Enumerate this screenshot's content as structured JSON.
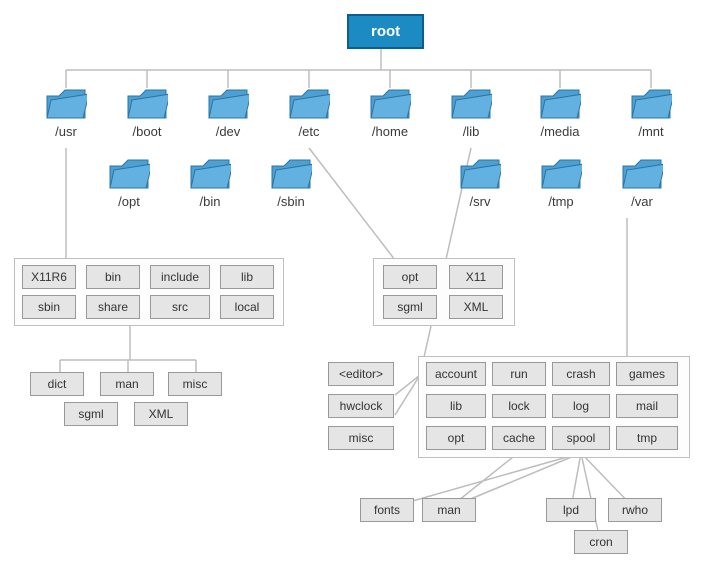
{
  "root": {
    "label": "root"
  },
  "dirs_row1": [
    "/usr",
    "/boot",
    "/dev",
    "/etc",
    "/home",
    "/lib",
    "/media",
    "/mnt"
  ],
  "dirs_row2": [
    "/opt",
    "/bin",
    "/sbin",
    "/srv",
    "/tmp",
    "/var"
  ],
  "usr_children_r1": [
    "X11R6",
    "bin",
    "include",
    "lib"
  ],
  "usr_children_r2": [
    "sbin",
    "share",
    "src",
    "local"
  ],
  "share_children_r1": [
    "dict",
    "man",
    "misc"
  ],
  "share_children_r2": [
    "sgml",
    "XML"
  ],
  "etc_children_r1": [
    "opt",
    "X11"
  ],
  "etc_children_r2": [
    "sgml",
    "XML"
  ],
  "lib_col": [
    "<editor>",
    "hwclock",
    "misc"
  ],
  "var_children_r1": [
    "account",
    "run",
    "crash",
    "games"
  ],
  "var_children_r2": [
    "lib",
    "lock",
    "log",
    "mail"
  ],
  "var_children_r3": [
    "opt",
    "cache",
    "spool",
    "tmp"
  ],
  "spool_row1": [
    "fonts",
    "man"
  ],
  "spool_row2": [
    "lpd",
    "rwho"
  ],
  "spool_row3": [
    "cron"
  ]
}
